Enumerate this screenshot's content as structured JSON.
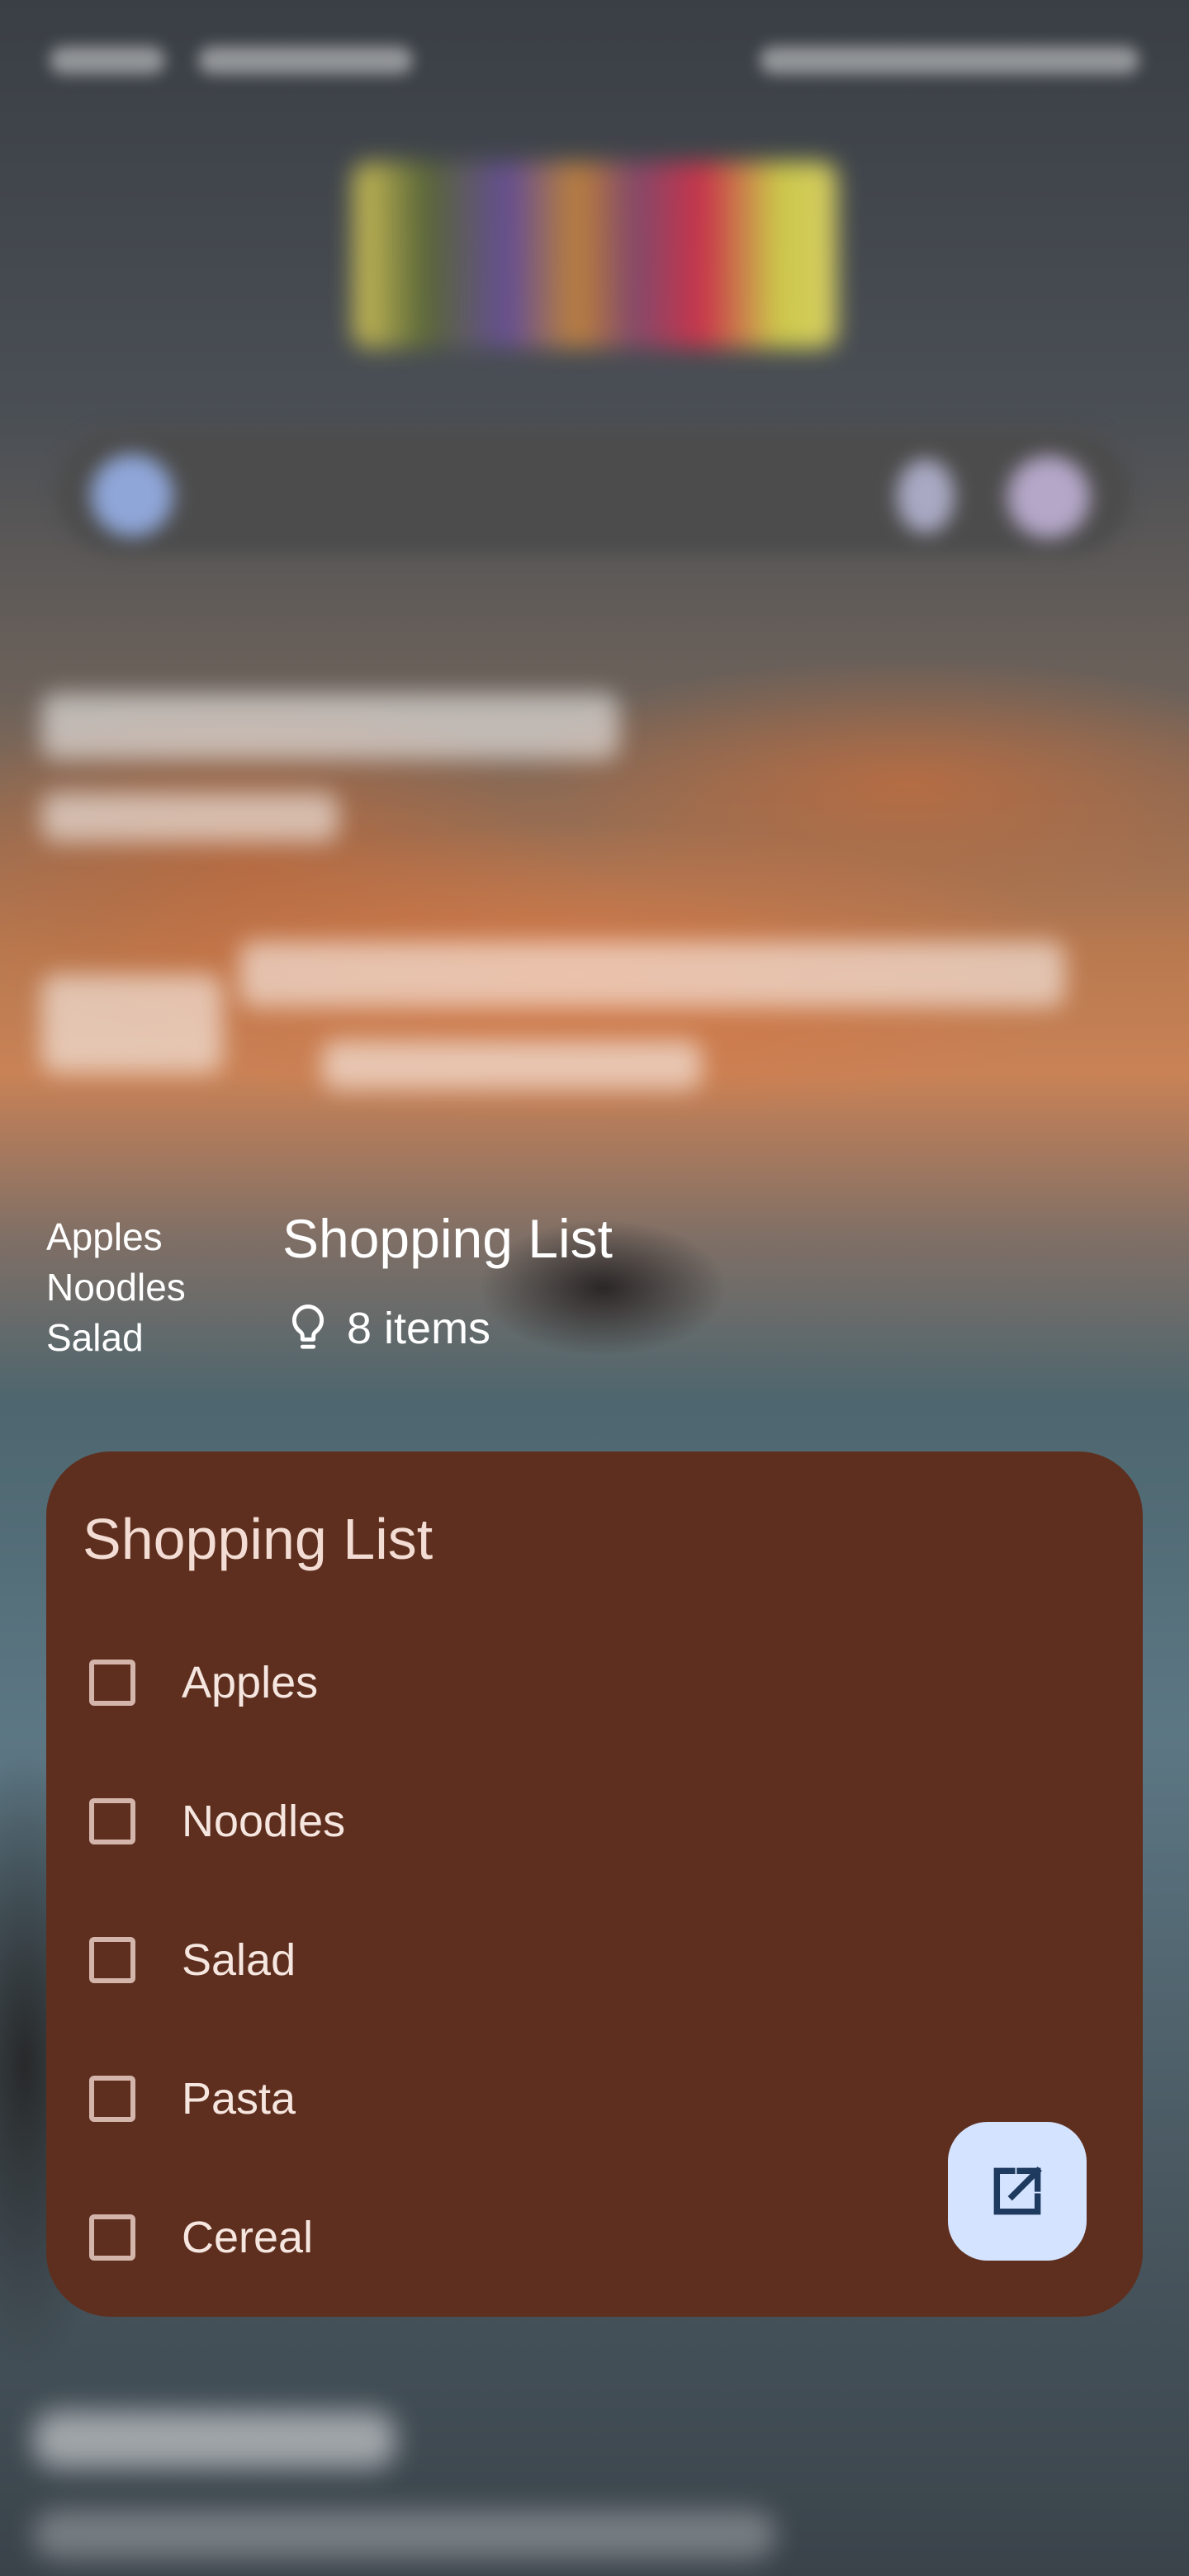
{
  "glance": {
    "items": [
      "Apples",
      "Noodles",
      "Salad"
    ],
    "title": "Shopping List",
    "count_label": "8 items",
    "icon": "lightbulb-icon"
  },
  "widget": {
    "title": "Shopping List",
    "background_color": "#5e2f1e",
    "items": [
      {
        "label": "Apples",
        "checked": false
      },
      {
        "label": "Noodles",
        "checked": false
      },
      {
        "label": "Salad",
        "checked": false
      },
      {
        "label": "Pasta",
        "checked": false
      },
      {
        "label": "Cereal",
        "checked": false
      }
    ],
    "open_button_icon": "open-in-new-icon",
    "open_button_color": "#d4e3ff"
  }
}
